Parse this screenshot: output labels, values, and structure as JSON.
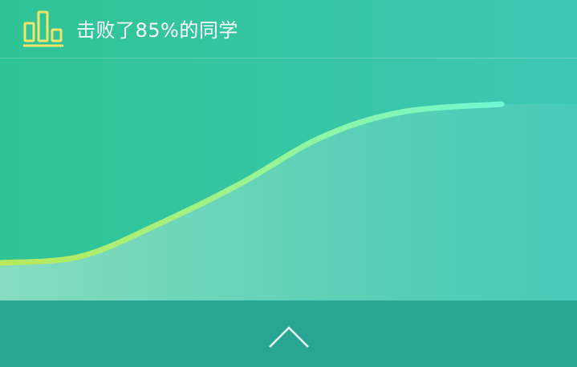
{
  "header": {
    "title": "击败了85%的同学",
    "icon": "bar-chart-icon"
  },
  "colors": {
    "background_left": "#2fc495",
    "background_right": "#3fc7b6",
    "footer": "#2ba593",
    "icon": "#f3e56a",
    "curve_start": "#b8e95a",
    "curve_end": "#6ff8d3"
  },
  "chart_data": {
    "type": "area",
    "x": [
      0,
      100,
      200,
      300,
      400,
      500,
      625
    ],
    "values": [
      0.0,
      0.04,
      0.25,
      0.5,
      0.79,
      0.95,
      1.0
    ]
  },
  "footer": {
    "collapse_icon": "chevron-up-icon"
  }
}
